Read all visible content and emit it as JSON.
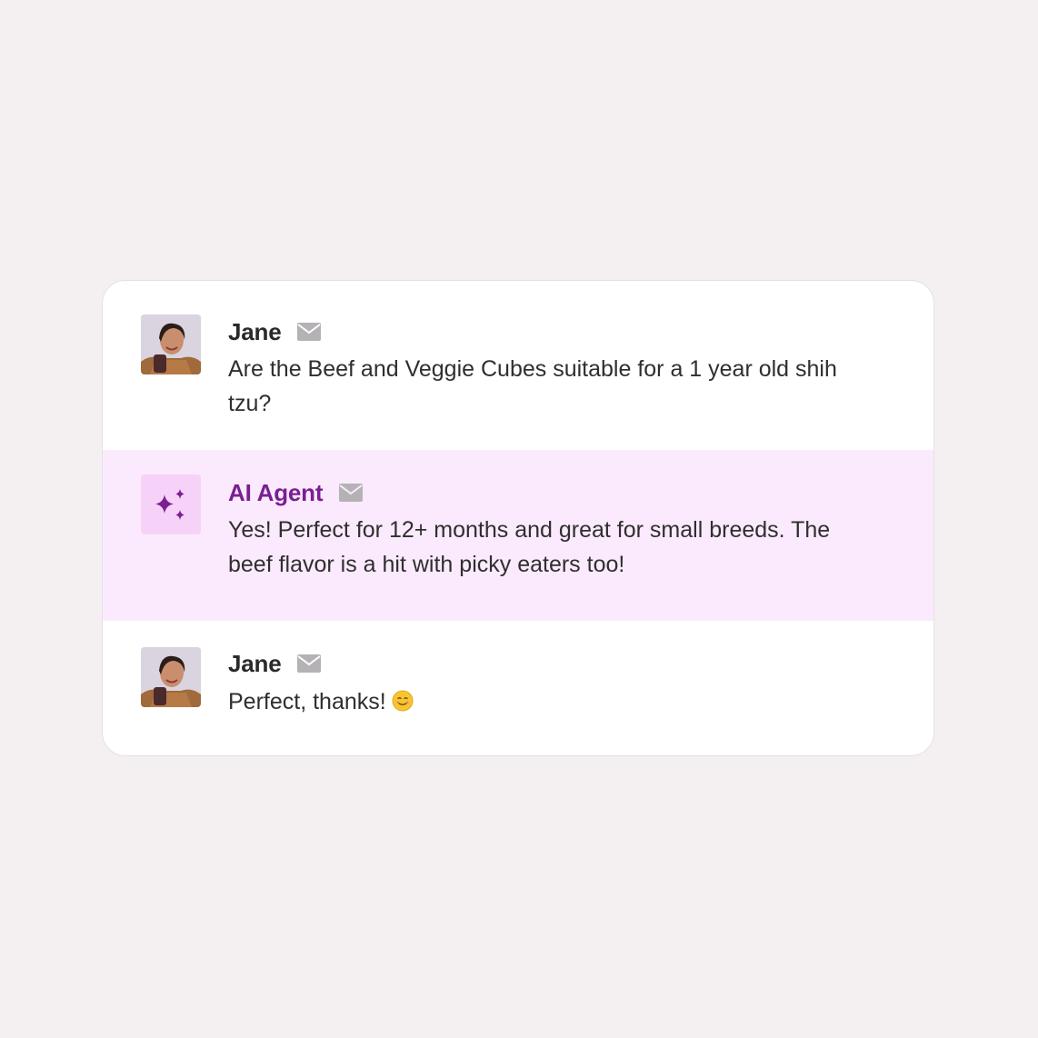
{
  "messages": [
    {
      "sender": "Jane",
      "text": "Are the Beef and Veggie Cubes suitable for a 1 year old shih tzu?",
      "avatar": "user-photo",
      "channel_icon": "mail-icon"
    },
    {
      "sender": "AI Agent",
      "text": "Yes! Perfect for 12+ months and great for small breeds. The beef flavor is a hit with picky eaters too!",
      "avatar": "sparkle-icon",
      "channel_icon": "mail-icon"
    },
    {
      "sender": "Jane",
      "text": "Perfect, thanks!",
      "emoji": "smiling-face-emoji",
      "avatar": "user-photo",
      "channel_icon": "mail-icon"
    }
  ],
  "colors": {
    "page_background": "#f4f0f2",
    "card_background": "#ffffff",
    "ai_row_background": "#fbeafd",
    "ai_accent": "#7a1f92",
    "ai_avatar_background": "#f6d2f8",
    "icon_gray": "#b5b2b5"
  }
}
